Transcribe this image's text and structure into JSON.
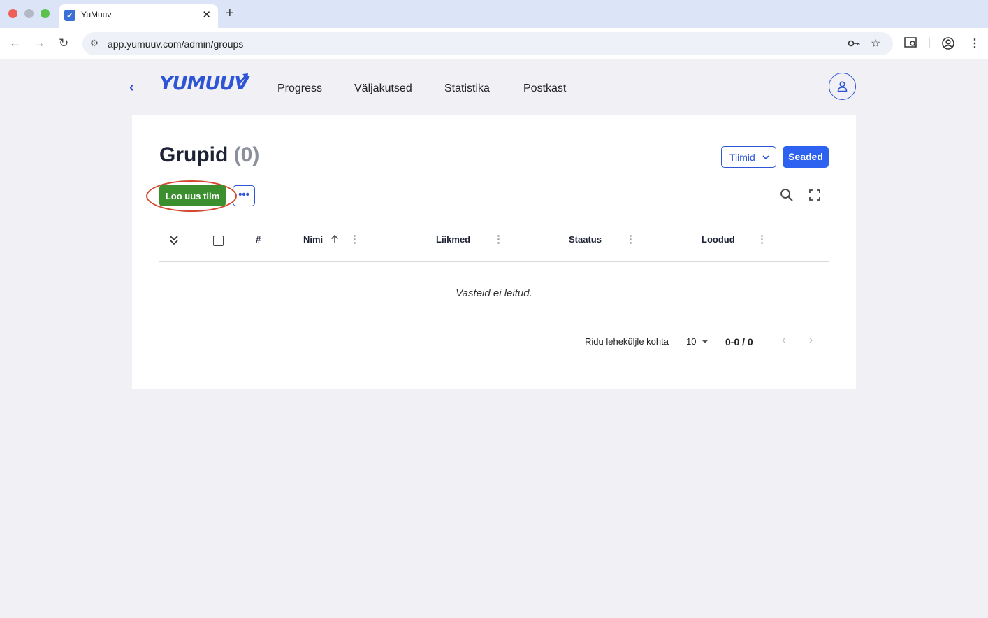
{
  "browser": {
    "tab_title": "YuMuuv",
    "tab_favicon": "✓",
    "url": "app.yumuuv.com/admin/groups"
  },
  "header": {
    "logo": "YUMUUV",
    "nav": [
      "Progress",
      "Väljakutsed",
      "Statistika",
      "Postkast"
    ]
  },
  "page": {
    "title": "Grupid",
    "count": "(0)",
    "teams_dropdown": "Tiimid",
    "settings_button": "Seaded",
    "create_button": "Loo uus tiim",
    "more_button": "•••"
  },
  "table": {
    "columns": {
      "number": "#",
      "name": "Nimi",
      "members": "Liikmed",
      "status": "Staatus",
      "created": "Loodud"
    },
    "empty_message": "Vasteid ei leitud."
  },
  "pagination": {
    "rows_label": "Ridu leheküljle kohta",
    "page_size": "10",
    "range": "0-0 / 0"
  },
  "icons": {
    "back": "chevron-left-icon",
    "expand_all": "double-chevron-down-icon",
    "search": "search-icon",
    "fullscreen": "fullscreen-icon",
    "sort": "arrow-up-icon"
  },
  "colors": {
    "brand_blue": "#2d55d6",
    "create_green": "#3c8f2f",
    "highlight_red": "#d2492f"
  }
}
